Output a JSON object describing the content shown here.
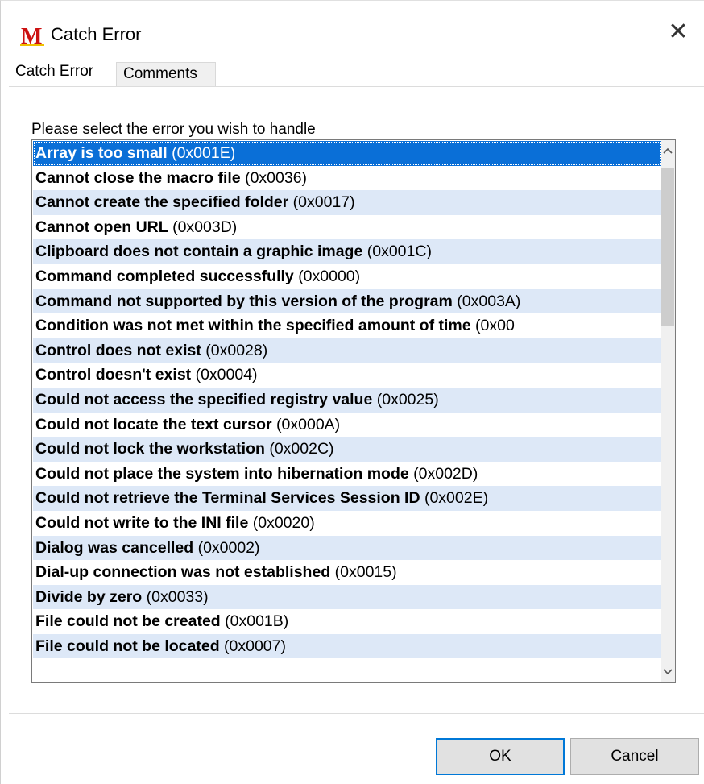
{
  "window": {
    "title": "Catch Error",
    "close_glyph": "✕",
    "app_icon_letter": "M",
    "app_icon_color": "#cc1111"
  },
  "tabs": [
    {
      "label": "Catch Error",
      "active": true
    },
    {
      "label": "Comments",
      "active": false
    }
  ],
  "prompt": "Please select the error you wish to handle",
  "errors": [
    {
      "name": "Array is too small",
      "code": "(0x001E)"
    },
    {
      "name": "Cannot close the macro file",
      "code": "(0x0036)"
    },
    {
      "name": "Cannot create the specified folder",
      "code": "(0x0017)"
    },
    {
      "name": "Cannot open URL",
      "code": "(0x003D)"
    },
    {
      "name": "Clipboard does not contain a graphic image",
      "code": "(0x001C)"
    },
    {
      "name": "Command completed successfully",
      "code": "(0x0000)"
    },
    {
      "name": "Command not supported by this version of the program",
      "code": "(0x003A)"
    },
    {
      "name": "Condition was not met within the specified amount of time",
      "code": "(0x00"
    },
    {
      "name": "Control does not exist",
      "code": "(0x0028)"
    },
    {
      "name": "Control doesn't exist",
      "code": "(0x0004)"
    },
    {
      "name": "Could not access the specified registry value",
      "code": "(0x0025)"
    },
    {
      "name": "Could not locate the text cursor",
      "code": "(0x000A)"
    },
    {
      "name": "Could not lock the workstation",
      "code": "(0x002C)"
    },
    {
      "name": "Could not place the system into hibernation mode",
      "code": "(0x002D)"
    },
    {
      "name": "Could not retrieve the Terminal Services Session ID",
      "code": "(0x002E)"
    },
    {
      "name": "Could not write to the INI file",
      "code": "(0x0020)"
    },
    {
      "name": "Dialog was cancelled",
      "code": "(0x0002)"
    },
    {
      "name": "Dial-up connection was not established",
      "code": "(0x0015)"
    },
    {
      "name": "Divide by zero",
      "code": "(0x0033)"
    },
    {
      "name": "File could not be created",
      "code": "(0x001B)"
    },
    {
      "name": "File could not be located",
      "code": "(0x0007)"
    }
  ],
  "selected_index": 0,
  "scrollbar": {
    "up_glyph": "^",
    "down_glyph": "v"
  },
  "buttons": {
    "ok": "OK",
    "cancel": "Cancel"
  },
  "colors": {
    "selection": "#0a6fd7",
    "alt_row": "#dde8f7",
    "default_button_border": "#0078d7"
  }
}
